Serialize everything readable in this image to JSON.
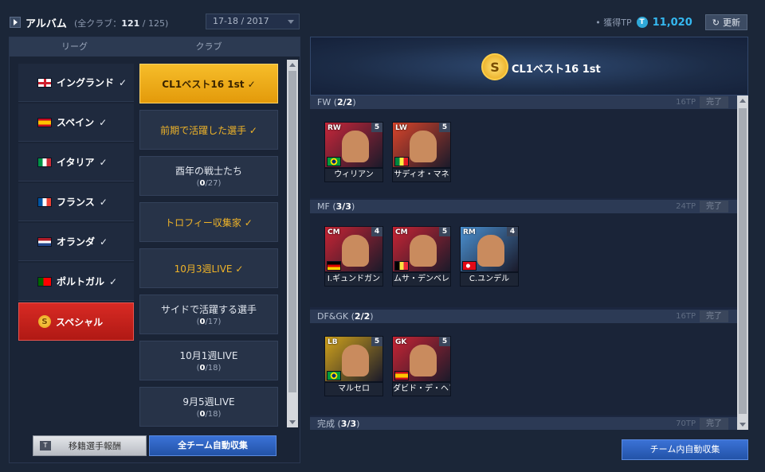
{
  "header": {
    "title": "アルバム",
    "count_prefix": "(全クラブ：",
    "count_current": "121",
    "count_sep": " / ",
    "count_total": "125",
    "count_suffix": ")",
    "season": "17-18 / 2017",
    "tp_label": "獲得TP",
    "tp_icon_letter": "T",
    "tp_value": "11,020",
    "refresh_label": "更新"
  },
  "left": {
    "league_header": "リーグ",
    "club_header": "クラブ",
    "leagues": [
      {
        "label": "イングランド",
        "check": "✓",
        "flag": "england"
      },
      {
        "label": "スペイン",
        "check": "✓",
        "flag": "spain"
      },
      {
        "label": "イタリア",
        "check": "✓",
        "flag": "italy"
      },
      {
        "label": "フランス",
        "check": "✓",
        "flag": "france"
      },
      {
        "label": "オランダ",
        "check": "✓",
        "flag": "netherlands"
      },
      {
        "label": "ポルトガル",
        "check": "✓",
        "flag": "portugal"
      },
      {
        "label": "スペシャル",
        "check": "",
        "flag": "coin"
      }
    ],
    "clubs": [
      {
        "label": "CL1ベスト16 1st ✓",
        "progress_cur": "",
        "progress_total": ""
      },
      {
        "label": "前期で活躍した選手 ✓",
        "progress_cur": "",
        "progress_total": ""
      },
      {
        "label": "酉年の戦士たち",
        "progress_cur": "0",
        "progress_total": "/27)"
      },
      {
        "label": "トロフィー収集家 ✓",
        "progress_cur": "",
        "progress_total": ""
      },
      {
        "label": "10月3週LIVE ✓",
        "progress_cur": "",
        "progress_total": ""
      },
      {
        "label": "サイドで活躍する選手",
        "progress_cur": "0",
        "progress_total": "/17)"
      },
      {
        "label": "10月1週LIVE",
        "progress_cur": "0",
        "progress_total": "/18)"
      },
      {
        "label": "9月5週LIVE",
        "progress_cur": "0",
        "progress_total": "/18)"
      }
    ],
    "transfer_button": "移籍選手報酬",
    "transfer_icon_letter": "T",
    "auto_all_button": "全チーム自動収集"
  },
  "right": {
    "banner_coin_letter": "S",
    "banner_title": "CL1ベスト16 1st",
    "sections": [
      {
        "name": "FW",
        "count": "2/2",
        "tp": "16TP",
        "done": "完了",
        "cards": [
          {
            "pos": "RW",
            "rank": "5",
            "name": "ウィリアン",
            "bg": "#c8263a",
            "flag": "brazil"
          },
          {
            "pos": "LW",
            "rank": "5",
            "name": "サディオ・マネ",
            "bg": "#d9442a",
            "flag": "senegal"
          }
        ]
      },
      {
        "name": "MF",
        "count": "3/3",
        "tp": "24TP",
        "done": "完了",
        "cards": [
          {
            "pos": "CM",
            "rank": "4",
            "name": "I.ギュンドガン",
            "bg": "#c82434",
            "flag": "germany"
          },
          {
            "pos": "CM",
            "rank": "5",
            "name": "ムサ・デンベレ",
            "bg": "#c82434",
            "flag": "belgium"
          },
          {
            "pos": "RM",
            "rank": "4",
            "name": "C.ユンデル",
            "bg": "#4a90d0",
            "flag": "turkey"
          }
        ]
      },
      {
        "name": "DF&GK",
        "count": "2/2",
        "tp": "16TP",
        "done": "完了",
        "cards": [
          {
            "pos": "LB",
            "rank": "5",
            "name": "マルセロ",
            "bg": "#d0a21c",
            "flag": "brazil"
          },
          {
            "pos": "GK",
            "rank": "5",
            "name": "ダビド・デ・ヘア",
            "bg": "#c82434",
            "flag": "spain"
          }
        ]
      },
      {
        "name": "完成",
        "count": "3/3",
        "tp": "70TP",
        "done": "完了",
        "cards": []
      }
    ],
    "team_auto_button": "チーム内自動収集"
  }
}
